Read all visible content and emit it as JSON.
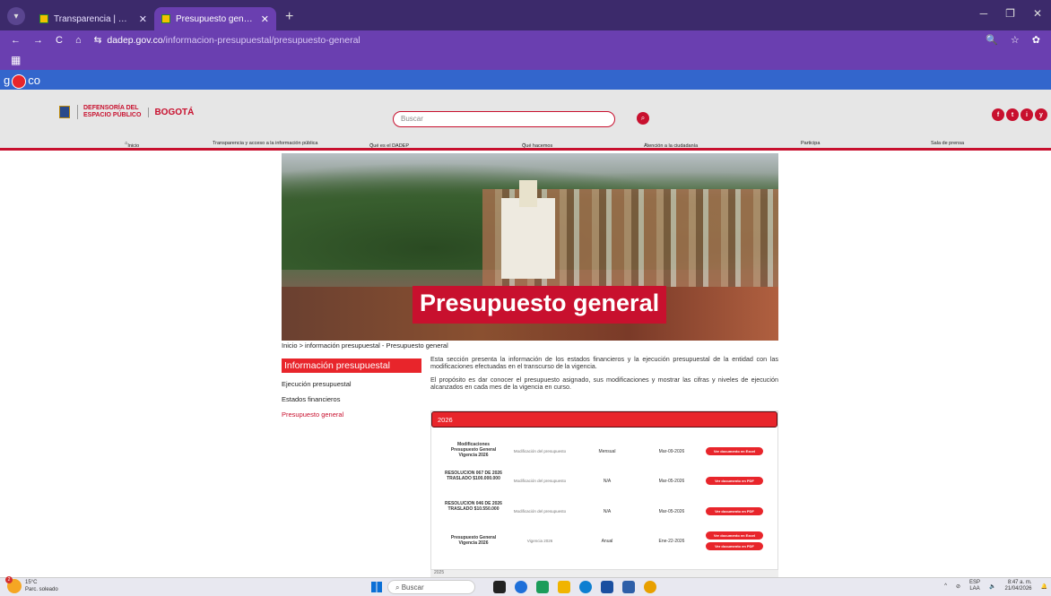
{
  "browser": {
    "tabs": [
      {
        "label": "Transparencia | Departamento ·"
      },
      {
        "label": "Presupuesto general | Departam"
      }
    ],
    "url_host": "dadep.gov.co",
    "url_path": "/informacion-presupuestal/presupuesto-general",
    "bookmarks_icon": "grid-icon"
  },
  "govbar": {
    "text_left": "g",
    "text_right": "co"
  },
  "header": {
    "defensoria_line1": "DEFENSORÍA DEL",
    "defensoria_line2": "ESPACIO PÚBLICO",
    "bogota": "BOGOTÁ",
    "search_placeholder": "Buscar",
    "social": [
      "f",
      "t",
      "i",
      "y"
    ]
  },
  "nav": [
    {
      "label": "Inicio"
    },
    {
      "label": "Transparencia y acceso a la información pública"
    },
    {
      "label": "Qué es el DADEP"
    },
    {
      "label": "Qué hacemos"
    },
    {
      "label": "Atención a la ciudadanía"
    },
    {
      "label": "Participa"
    },
    {
      "label": "Sala de prensa"
    }
  ],
  "hero": {
    "title": "Presupuesto general"
  },
  "breadcrumb": "Inicio  >  información presupuestal - Presupuesto general",
  "sidebar": {
    "title": "Información presupuestal",
    "items": [
      {
        "label": "Ejecución presupuestal"
      },
      {
        "label": "Estados financieros"
      },
      {
        "label": "Presupuesto general"
      }
    ]
  },
  "intro": {
    "p1": "Esta sección presenta la información de los estados financieros y la ejecución presupuestal de la entidad con las modificaciones efectuadas en el transcurso de la vigencia.",
    "p2": "El propósito es dar conocer el presupuesto asignado, sus modificaciones y mostrar las cifras y niveles de ejecución alcanzados en cada mes de la vigencia en curso."
  },
  "year_section": {
    "year": "2026",
    "rows": [
      {
        "name": "Modificaciones Presupuesto General Vigencia 2026",
        "type": "Modificación del presupuesto",
        "freq": "Mensual",
        "date": "Mar-09-2026",
        "buttons": [
          "Ver documento en Excel"
        ]
      },
      {
        "name": "RESOLUCION 067 DE 2026 TRASLADO $100.000.000",
        "type": "Modificación del presupuesto",
        "freq": "N/A",
        "date": "Mar-05-2026",
        "buttons": [
          "Ver documento en PDF"
        ]
      },
      {
        "name": "RESOLUCION 046 DE 2026 TRASLADO $10.550.000",
        "type": "Modificación del presupuesto",
        "freq": "N/A",
        "date": "Mar-05-2026",
        "buttons": [
          "Ver documento en PDF"
        ]
      },
      {
        "name": "Presupuesto General Vigencia 2026",
        "type": "Vigencia 2026",
        "freq": "Anual",
        "date": "Ene-22-2026",
        "buttons": [
          "Ver documento en Excel",
          "Ver documento en PDF"
        ]
      }
    ],
    "next_year": "2025"
  },
  "taskbar": {
    "temp": "15°C",
    "weather": "Parc. soleado",
    "weather_badge": "2",
    "search": "Buscar",
    "lang1": "ESP",
    "lang2": "LAA",
    "time": "8:47 a. m.",
    "date": "21/04/2026"
  }
}
